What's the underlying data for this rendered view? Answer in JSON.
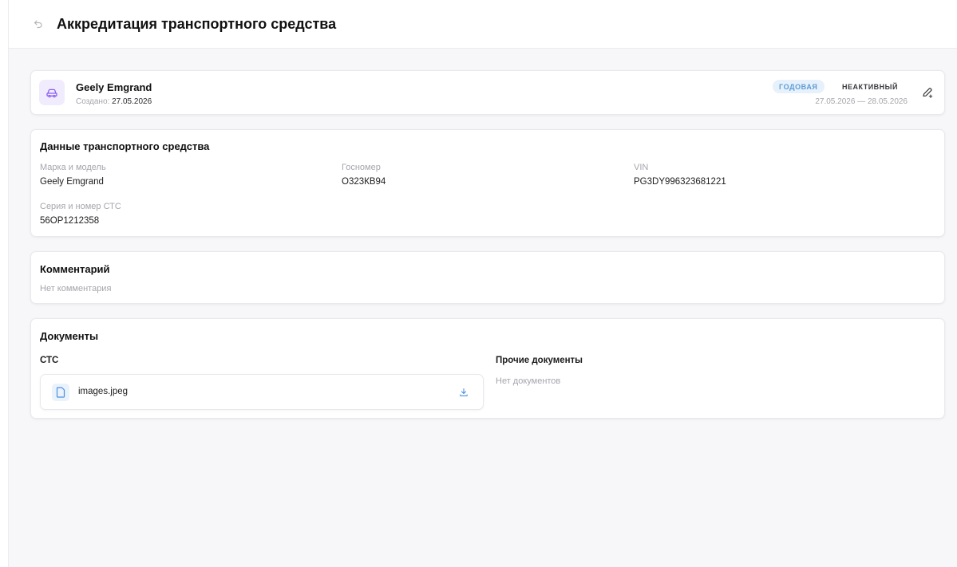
{
  "header": {
    "title": "Аккредитация транспортного средства",
    "back_icon": "back-arrow-icon"
  },
  "vehicle": {
    "name": "Geely Emgrand",
    "created_label": "Создано:",
    "created_date": "27.05.2026",
    "icon": "car-icon",
    "accent_color": "#8b5cf6",
    "badge_type": "ГОДОВАЯ",
    "badge_status": "НЕАКТИВНЫЙ",
    "period": "27.05.2026 — 28.05.2026",
    "edit_icon": "edit-pencil-icon"
  },
  "vehicle_data": {
    "title": "Данные транспортного средства",
    "fields": [
      {
        "label": "Марка и модель",
        "value": "Geely Emgrand"
      },
      {
        "label": "Госномер",
        "value": "О323КВ94"
      },
      {
        "label": "VIN",
        "value": "PG3DY996323681221"
      },
      {
        "label": "Серия и номер СТС",
        "value": "56ОР1212358"
      }
    ]
  },
  "comment": {
    "title": "Комментарий",
    "empty_text": "Нет комментария"
  },
  "documents": {
    "title": "Документы",
    "sts": {
      "title": "СТС",
      "files": [
        {
          "name": "images.jpeg",
          "icon": "file-icon",
          "action_icon": "download-icon"
        }
      ]
    },
    "other": {
      "title": "Прочие документы",
      "empty_text": "Нет документов"
    }
  },
  "colors": {
    "badge_annual_bg": "#e6f1fb",
    "badge_annual_text": "#5c9bd6",
    "muted_text": "#a5a5ad",
    "file_icon": "#4a90e2"
  }
}
